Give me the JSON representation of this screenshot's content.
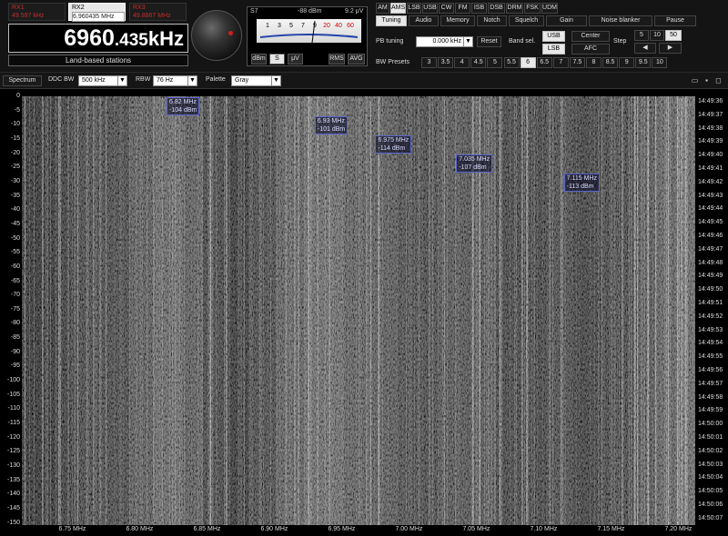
{
  "receivers": [
    {
      "name": "RX1",
      "freq": "49.597 kHz"
    },
    {
      "name": "RX2",
      "freq": "6.960435 MHz"
    },
    {
      "name": "RX3",
      "freq": "49.8867 MHz"
    }
  ],
  "frequency": {
    "main": "6960",
    "fraction": ".435",
    "unit": "kHz"
  },
  "station": "Land-based stations",
  "smeter": {
    "s_label": "S7",
    "dbm": "-88 dBm",
    "uv": "9.2 μV",
    "scale": [
      "1",
      "3",
      "5",
      "7",
      "9",
      "20",
      "40",
      "60"
    ],
    "buttons": [
      "dBm",
      "S",
      "μV",
      "RMS",
      "AVG"
    ]
  },
  "modes": [
    "AM",
    "AMS",
    "LSB",
    "USB",
    "CW",
    "FM",
    "ISB",
    "DSB",
    "DRM",
    "FSK",
    "UDM"
  ],
  "active_mode": "AMS",
  "function_tabs": [
    "Tuning",
    "Audio",
    "Memory",
    "Notch",
    "Squelch",
    "Gain",
    "Noise blanker",
    "Pause"
  ],
  "active_tab": "Tuning",
  "pb_tuning": {
    "label": "PB tuning",
    "value": "0.000 kHz",
    "reset": "Reset"
  },
  "band_sel": {
    "label": "Band sel.",
    "usb": "USB",
    "lsb": "LSB"
  },
  "center_afc": {
    "center": "Center",
    "afc": "AFC"
  },
  "step": {
    "label": "Step",
    "values": [
      "5",
      "10",
      "50"
    ],
    "left": "◀",
    "right": "▶"
  },
  "bw_presets": {
    "label": "BW Presets",
    "values": [
      "3",
      "3.5",
      "4",
      "4.5",
      "5",
      "5.5",
      "6",
      "6.5",
      "7",
      "7.5",
      "8",
      "8.5",
      "9",
      "9.5",
      "10"
    ],
    "active": "6"
  },
  "toolbar": {
    "spectrum": "Spectrum",
    "ddc_bw_label": "DDC BW",
    "ddc_bw": "500 kHz",
    "rbw_label": "RBW",
    "rbw": "76 Hz",
    "palette_label": "Palette",
    "palette": "Gray"
  },
  "y_ticks": [
    "0",
    "-5",
    "-10",
    "-15",
    "-20",
    "-25",
    "-30",
    "-35",
    "-40",
    "-45",
    "-50",
    "-55",
    "-60",
    "-65",
    "-70",
    "-75",
    "-80",
    "-85",
    "-90",
    "-95",
    "-100",
    "-105",
    "-110",
    "-115",
    "-120",
    "-125",
    "-130",
    "-135",
    "-140",
    "-145",
    "-150"
  ],
  "time_ticks": [
    "14:49:36",
    "14:49:37",
    "14:49:38",
    "14:49:39",
    "14:49:40",
    "14:49:41",
    "14:49:42",
    "14:49:43",
    "14:49:44",
    "14:49:45",
    "14:49:46",
    "14:49:47",
    "14:49:48",
    "14:49:49",
    "14:49:50",
    "14:49:51",
    "14:49:52",
    "14:49:53",
    "14:49:54",
    "14:49:55",
    "14:49:56",
    "14:49:57",
    "14:49:58",
    "14:49:59",
    "14:50:00",
    "14:50:01",
    "14:50:02",
    "14:50:03",
    "14:50:04",
    "14:50:05",
    "14:50:06",
    "14:50:07"
  ],
  "freq_axis": {
    "labels": [
      "6.75 MHz",
      "6.80 MHz",
      "6.85 MHz",
      "6.90 MHz",
      "6.95 MHz",
      "7.00 MHz",
      "7.05 MHz",
      "7.10 MHz",
      "7.15 MHz",
      "7.20 MHz"
    ],
    "values": [
      6.75,
      6.8,
      6.85,
      6.9,
      6.95,
      7.0,
      7.05,
      7.1,
      7.15,
      7.2
    ],
    "min": 6.7105,
    "max": 7.2105
  },
  "markers": [
    {
      "freq": "6.82 MHz",
      "level": "-104 dBm",
      "mhz": 6.82,
      "row": 0
    },
    {
      "freq": "6.93 MHz",
      "level": "-101 dBm",
      "mhz": 6.93,
      "row": 2
    },
    {
      "freq": "6.975 MHz",
      "level": "-114 dBm",
      "mhz": 6.975,
      "row": 4
    },
    {
      "freq": "7.035 MHz",
      "level": "-107 dBm",
      "mhz": 7.035,
      "row": 6
    },
    {
      "freq": "7.115 MHz",
      "level": "-113 dBm",
      "mhz": 7.115,
      "row": 8
    }
  ],
  "window_icons": [
    "tile-icon",
    "save-icon",
    "fullscreen-icon"
  ]
}
